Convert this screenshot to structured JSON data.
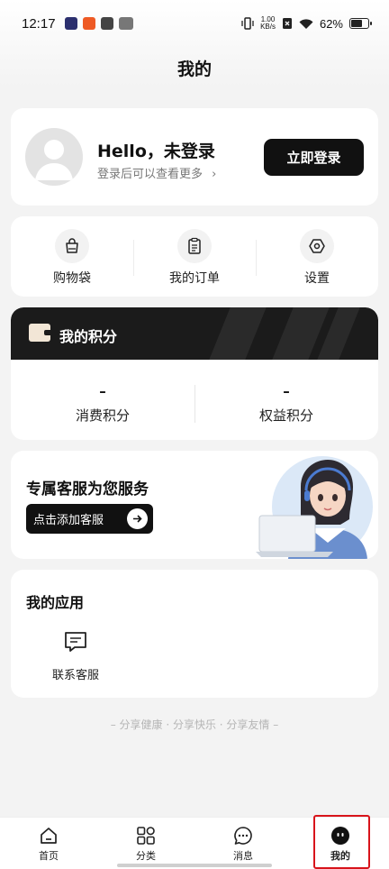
{
  "status_bar": {
    "time": "12:17",
    "net_speed_value": "1.00",
    "net_speed_unit": "KB/s",
    "battery": "62%"
  },
  "page": {
    "title": "我的"
  },
  "profile": {
    "greeting": "Hello，未登录",
    "subtitle": "登录后可以查看更多",
    "login_button": "立即登录"
  },
  "shortcuts": [
    {
      "label": "购物袋",
      "icon": "shopping-bag-icon"
    },
    {
      "label": "我的订单",
      "icon": "clipboard-icon"
    },
    {
      "label": "设置",
      "icon": "settings-hexagon-icon"
    }
  ],
  "points": {
    "title": "我的积分",
    "items": [
      {
        "value": "–",
        "label": "消费积分"
      },
      {
        "value": "–",
        "label": "权益积分"
      }
    ]
  },
  "service": {
    "title": "专属客服为您服务",
    "button": "点击添加客服"
  },
  "apps": {
    "title": "我的应用",
    "items": [
      {
        "label": "联系客服",
        "icon": "chat-message-icon"
      }
    ]
  },
  "slogan": "– 分享健康 · 分享快乐 · 分享友情 –",
  "tabbar": [
    {
      "label": "首页",
      "icon": "home-icon"
    },
    {
      "label": "分类",
      "icon": "category-grid-icon"
    },
    {
      "label": "消息",
      "icon": "message-bubble-icon"
    },
    {
      "label": "我的",
      "icon": "profile-face-icon",
      "active": true
    }
  ],
  "colors": {
    "accent": "#111111",
    "highlight": "#d8141b"
  }
}
